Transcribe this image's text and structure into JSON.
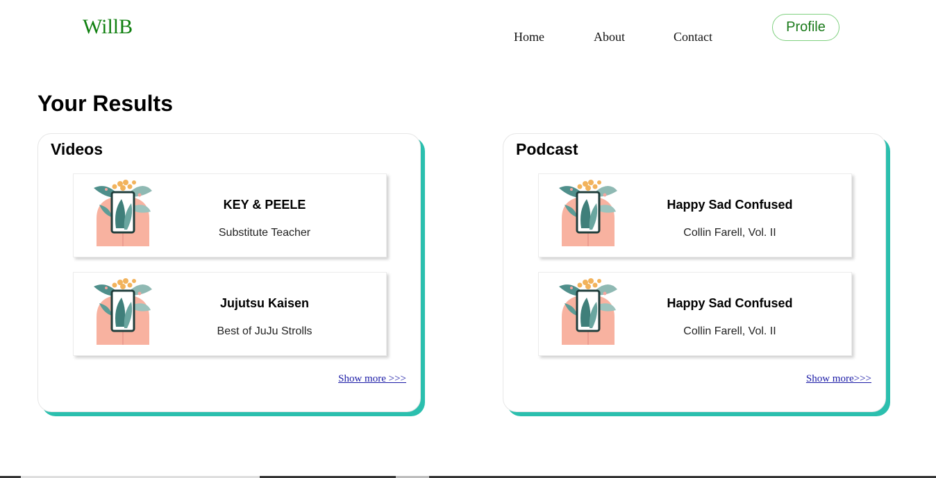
{
  "header": {
    "brand": "WillB",
    "nav": [
      {
        "label": "Home"
      },
      {
        "label": "About"
      },
      {
        "label": "Contact"
      }
    ],
    "profile_label": "Profile"
  },
  "main": {
    "title": "Your Results",
    "panels": [
      {
        "title": "Videos",
        "cards": [
          {
            "title": "KEY & PEELE",
            "subtitle": "Substitute Teacher"
          },
          {
            "title": "Jujutsu Kaisen",
            "subtitle": "Best of JuJu Strolls"
          }
        ],
        "show_more": "Show more >>>"
      },
      {
        "title": "Podcast",
        "cards": [
          {
            "title": "Happy Sad Confused",
            "subtitle": "Collin Farell, Vol. II"
          },
          {
            "title": "Happy Sad Confused",
            "subtitle": "Collin Farell, Vol. II"
          }
        ],
        "show_more": "Show more>>>"
      }
    ]
  },
  "colors": {
    "brand": "#108010",
    "panel_shadow": "#2bbfae",
    "link": "#1a1aa6"
  }
}
